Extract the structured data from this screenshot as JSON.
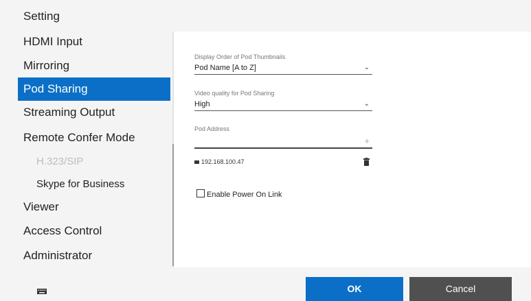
{
  "window": {
    "title": "Setting"
  },
  "sidebar": {
    "items": [
      {
        "label": "HDMI Input"
      },
      {
        "label": "Mirroring"
      },
      {
        "label": "Pod Sharing"
      },
      {
        "label": "Streaming Output"
      },
      {
        "label": "Remote Confer Mode"
      },
      {
        "label": "H.323/SIP"
      },
      {
        "label": "Skype for Business"
      },
      {
        "label": "Viewer"
      },
      {
        "label": "Access Control"
      },
      {
        "label": "Administrator"
      }
    ],
    "selected": "Pod Sharing"
  },
  "main": {
    "display_order": {
      "label": "Display Order of Pod Thumbnails",
      "value": "Pod Name [A to Z]"
    },
    "video_quality": {
      "label": "Video quality for Pod Sharing",
      "value": "High"
    },
    "pod_address": {
      "label": "Pod Address",
      "entries": [
        {
          "address": "192.168.100.47"
        }
      ]
    },
    "enable_power_on_link": {
      "label": "Enable Power On Link",
      "checked": false
    }
  },
  "footer": {
    "ok_label": "OK",
    "cancel_label": "Cancel"
  },
  "colors": {
    "accent": "#0b6fc7",
    "cancel": "#505050",
    "panel": "#f4f4f4"
  }
}
